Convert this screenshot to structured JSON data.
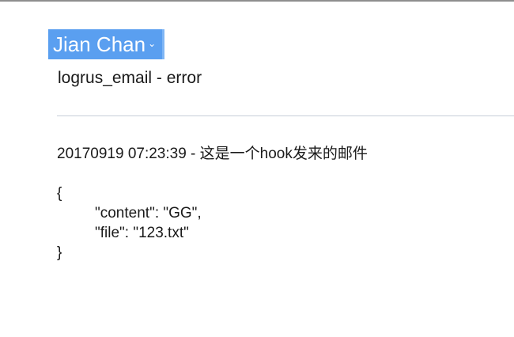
{
  "header": {
    "sender_name": "Jian Chan",
    "sender_menu_icon": "chevron-down-icon",
    "subject": "logrus_email - error"
  },
  "body": {
    "headline": "20170919 07:23:39 - 这是一个hook发来的邮件",
    "json_open": "{",
    "json_lines": [
      "\"content\": \"GG\",",
      "\"file\": \"123.txt\""
    ],
    "json_close": "}"
  },
  "colors": {
    "sender_badge": "#5a9ff0",
    "divider": "#c6cdd8"
  }
}
